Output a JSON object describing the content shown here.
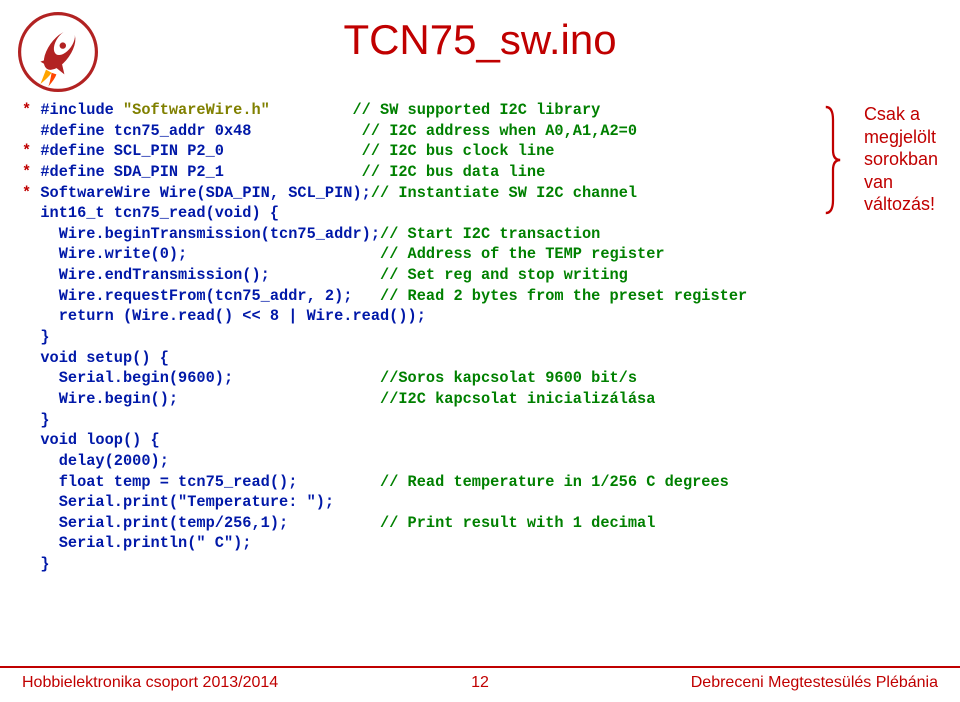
{
  "title": "TCN75_sw.ino",
  "annotation": {
    "line1": "Csak a",
    "line2": "megjelölt",
    "line3": "sorokban",
    "line4": "van",
    "line5": "változás!"
  },
  "code": {
    "l1_star": "*",
    "l1_inc": " #include ",
    "l1_str": "\"SoftwareWire.h\"",
    "l1_pad": "         ",
    "l1_cmt": "// SW supported I2C library",
    "l2_ind": "  #define tcn75_addr 0x48            ",
    "l2_cmt": "// I2C address when A0,A1,A2=0",
    "l3_star": "*",
    "l3_ind": " #define SCL_PIN P2_0               ",
    "l3_cmt": "// I2C bus clock line",
    "l4_star": "*",
    "l4_ind": " #define SDA_PIN P2_1               ",
    "l4_cmt": "// I2C bus data line",
    "l5_star": "*",
    "l5_ind": " SoftwareWire Wire(SDA_PIN, SCL_PIN);",
    "l5_cmt": "// Instantiate SW I2C channel",
    "l6": "  int16_t tcn75_read(void) {",
    "l7a": "    Wire.beginTransmission(tcn75_addr);",
    "l7_cmt": "// Start I2C transaction",
    "l8a": "    Wire.write(0);                     ",
    "l8_cmt": "// Address of the TEMP register",
    "l9a": "    Wire.endTransmission();            ",
    "l9_cmt": "// Set reg and stop writing",
    "l10a": "    Wire.requestFrom(tcn75_addr, 2);   ",
    "l10_cmt": "// Read 2 bytes from the preset register",
    "l11": "    return (Wire.read() << 8 | Wire.read());",
    "l12": "  }",
    "l13": "  void setup() {",
    "l14a": "    Serial.begin(9600);                ",
    "l14_cmt": "//Soros kapcsolat 9600 bit/s",
    "l15a": "    Wire.begin();                      ",
    "l15_cmt": "//I2C kapcsolat inicializálása",
    "l16": "  }",
    "l17": "  void loop() {",
    "l18": "    delay(2000);",
    "l19a": "    float temp = tcn75_read();         ",
    "l19_cmt": "// Read temperature in 1/256 C degrees",
    "l20": "    Serial.print(\"Temperature: \");",
    "l21a": "    Serial.print(temp/256,1);          ",
    "l21_cmt": "// Print result with 1 decimal",
    "l22": "    Serial.println(\" C\");",
    "l23": "  }"
  },
  "footer": {
    "left": "Hobbielektronika csoport 2013/2014",
    "center": "12",
    "right": "Debreceni Megtestesülés Plébánia"
  }
}
